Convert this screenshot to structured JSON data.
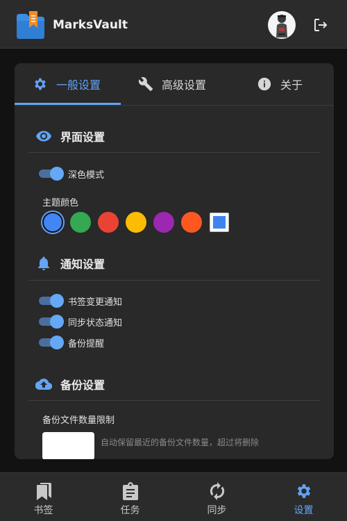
{
  "header": {
    "app_name": "MarksVault",
    "logo_icon": "bookmark-folder-icon",
    "avatar_icon": "user-avatar",
    "logout_icon": "logout-icon"
  },
  "tabs": [
    {
      "label": "一般设置",
      "icon": "gear-icon",
      "active": true
    },
    {
      "label": "高级设置",
      "icon": "wrench-icon",
      "active": false
    },
    {
      "label": "关于",
      "icon": "info-icon",
      "active": false
    }
  ],
  "interface": {
    "title": "界面设置",
    "icon": "eye-icon",
    "dark_mode_label": "深色模式",
    "dark_mode_on": true,
    "theme_color_label": "主题颜色",
    "theme_colors": [
      "#4285f4",
      "#34a853",
      "#ea4335",
      "#fbbc05",
      "#9c27b0",
      "#ff5722"
    ],
    "selected_color": "#4285f4",
    "custom_color": "#3d84f0"
  },
  "notifications": {
    "title": "通知设置",
    "icon": "bell-icon",
    "items": [
      {
        "label": "书签变更通知",
        "on": true
      },
      {
        "label": "同步状态通知",
        "on": true
      },
      {
        "label": "备份提醒",
        "on": true
      }
    ]
  },
  "backup": {
    "title": "备份设置",
    "icon": "cloud-upload-icon",
    "limit_label": "备份文件数量限制",
    "limit_value": "",
    "hint": "自动保留最近的备份文件数量，超过将删除"
  },
  "bottom_nav": [
    {
      "label": "书签",
      "icon": "bookmarks-icon",
      "active": false
    },
    {
      "label": "任务",
      "icon": "clipboard-icon",
      "active": false
    },
    {
      "label": "同步",
      "icon": "sync-icon",
      "active": false
    },
    {
      "label": "设置",
      "icon": "gear-icon",
      "active": true
    }
  ],
  "colors": {
    "accent": "#63a4f4",
    "surface": "#292929",
    "background": "#121212"
  }
}
